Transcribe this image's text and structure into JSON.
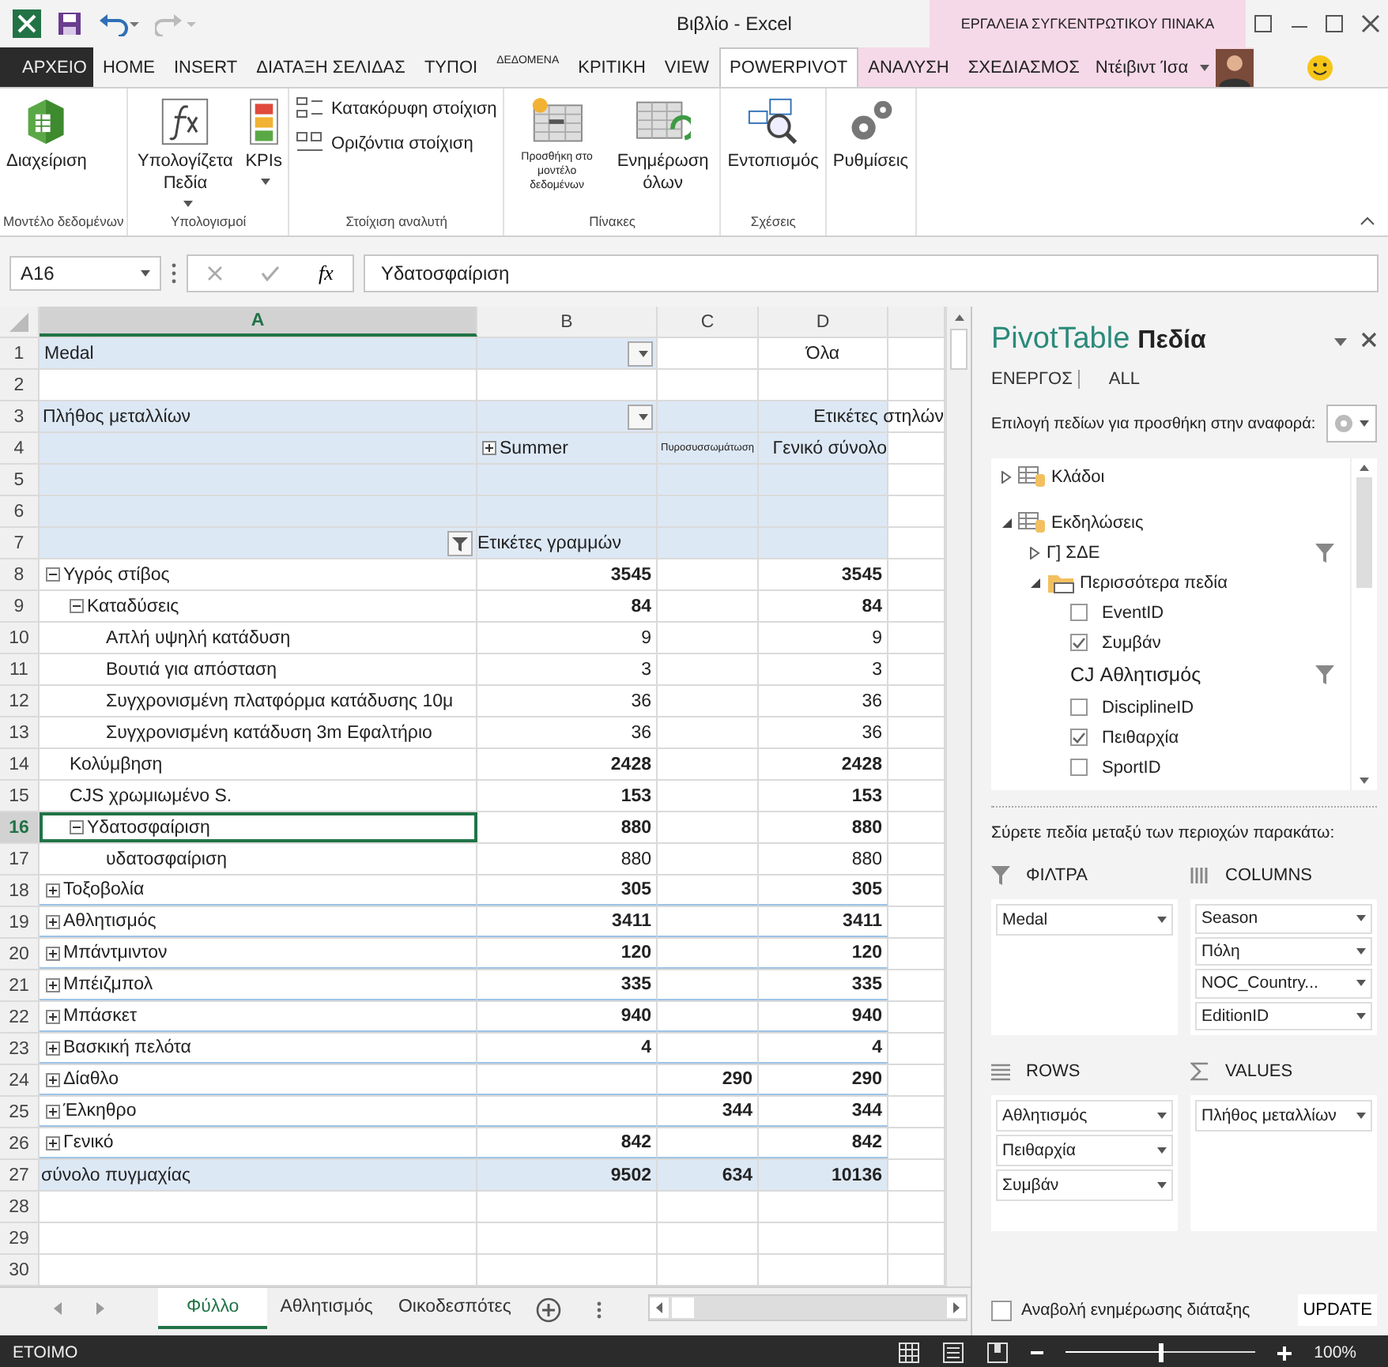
{
  "window": {
    "title": "Βιβλίο - Excel",
    "context_title": "ΕΡΓΑΛΕΙΑ ΣΥΓΚΕΝΤΡΩΤΙΚΟΥ ΠΙΝΑΚΑ",
    "user": "Ντέιβιντ Ίσα"
  },
  "ribbon": {
    "tabs": [
      {
        "label": "ΑΡΧΕΙΟ",
        "kind": "file",
        "selected": false
      },
      {
        "label": "HOME",
        "kind": "tab",
        "selected": false
      },
      {
        "label": "INSERT",
        "kind": "tab",
        "selected": false
      },
      {
        "label": "ΔΙΑΤΑΞΗ ΣΕΛΙΔΑΣ",
        "kind": "tab",
        "selected": false
      },
      {
        "label": "ΤΥΠΟΙ",
        "kind": "tab",
        "selected": false
      },
      {
        "label": "ΔΕΔΟΜΕΝΑ",
        "kind": "compact",
        "selected": false
      },
      {
        "label": "ΚΡΙΤΙΚΗ",
        "kind": "tab",
        "selected": false
      },
      {
        "label": "VIEW",
        "kind": "tab",
        "selected": false
      },
      {
        "label": "POWERPIVOT",
        "kind": "tab",
        "selected": true
      },
      {
        "label": "ΑΝΑΛΥΣΗ",
        "kind": "context",
        "selected": false
      },
      {
        "label": "ΣΧΕΔΙΑΣΜΟΣ",
        "kind": "context",
        "selected": false
      }
    ],
    "groups": [
      {
        "label": "Μοντέλο δεδομένων",
        "buttons": [
          {
            "label": "Διαχείριση",
            "kind": "large",
            "dropdown": false
          }
        ]
      },
      {
        "label": "Υπολογισμοί",
        "buttons": [
          {
            "label": "Υπολογίζετα Πεδία",
            "kind": "large",
            "dropdown": true
          },
          {
            "label": "KPIs",
            "kind": "large",
            "dropdown": true
          }
        ]
      },
      {
        "label": "Στοίχιση αναλυτή",
        "buttons": [
          {
            "label": "Κατακόρυφη στοίχιση",
            "kind": "small",
            "dropdown": false
          },
          {
            "label": "Οριζόντια στοίχιση",
            "kind": "small",
            "dropdown": false
          }
        ]
      },
      {
        "label": "Πίνακες",
        "buttons": [
          {
            "label": "Προσθήκη στο μοντέλο δεδομένων",
            "kind": "compact",
            "dropdown": false
          },
          {
            "label": "Ενημέρωση όλων",
            "kind": "large",
            "dropdown": false
          }
        ]
      },
      {
        "label": "Σχέσεις",
        "buttons": [
          {
            "label": "Εντοπισμός",
            "kind": "large",
            "dropdown": false
          }
        ]
      },
      {
        "buttons": [
          {
            "label": "Ρυθμίσεις",
            "kind": "large",
            "dropdown": false
          }
        ]
      }
    ]
  },
  "formula_bar": {
    "name_box": "A16",
    "function_button": "fx",
    "formula": "Υδατοσφαίριση"
  },
  "sheet": {
    "columns": [
      {
        "label": "A",
        "selected": true
      },
      {
        "label": "B",
        "selected": false
      },
      {
        "label": "C",
        "selected": false
      },
      {
        "label": "D",
        "selected": false
      }
    ],
    "rows": [
      {
        "number": "1",
        "kind": "filter",
        "label": "Medal",
        "value": "Όλα"
      },
      {
        "number": "2",
        "kind": "blank"
      },
      {
        "number": "3",
        "kind": "values_header",
        "label": "Πλήθος μεταλλίων",
        "note": "Ετικέτες στηλών"
      },
      {
        "number": "4",
        "kind": "column_labels",
        "labels": [
          "Summer",
          "Πυροσυσσωμάτωση",
          "Γενικό σύνολο"
        ]
      },
      {
        "number": "5",
        "kind": "header_blank"
      },
      {
        "number": "6",
        "kind": "header_blank"
      },
      {
        "number": "7",
        "kind": "row_labels",
        "caption": "Ετικέτες γραμμών"
      },
      {
        "number": "8",
        "kind": "item",
        "label": "Υγρός στίβος",
        "expanded": true,
        "selected": false,
        "values": {
          "b": "3545",
          "d": "3545"
        },
        "children": [
          {
            "number": "9",
            "kind": "item",
            "label": "Καταδύσεις",
            "expanded": true,
            "selected": false,
            "values": {
              "b": "84",
              "d": "84"
            },
            "children": [
              {
                "number": "10",
                "kind": "item",
                "label": "Απλή υψηλή κατάδυση",
                "selected": false,
                "values": {
                  "b": "9",
                  "d": "9"
                }
              },
              {
                "number": "11",
                "kind": "item",
                "label": "Βουτιά για απόσταση",
                "selected": false,
                "values": {
                  "b": "3",
                  "d": "3"
                }
              },
              {
                "number": "12",
                "kind": "item",
                "label": "Συγχρονισμένη πλατφόρμα κατάδυσης 10μ",
                "selected": false,
                "values": {
                  "b": "36",
                  "d": "36"
                }
              },
              {
                "number": "13",
                "kind": "item",
                "label": "Συγχρονισμένη κατάδυση 3m Εφαλτήριο",
                "selected": false,
                "values": {
                  "b": "36",
                  "d": "36"
                }
              }
            ]
          },
          {
            "number": "14",
            "kind": "item",
            "label": "Κολύμβηση",
            "selected": false,
            "values": {
              "b": "2428",
              "d": "2428"
            }
          },
          {
            "number": "15",
            "kind": "item",
            "label": "CJS χρωμιωμένο S.",
            "selected": false,
            "values": {
              "b": "153",
              "d": "153"
            }
          },
          {
            "number": "16",
            "kind": "item",
            "label": "Υδατοσφαίριση",
            "expanded": true,
            "selected": true,
            "values": {
              "b": "880",
              "d": "880"
            },
            "children": [
              {
                "number": "17",
                "kind": "item",
                "label": "υδατοσφαίριση",
                "selected": false,
                "values": {
                  "b": "880",
                  "d": "880"
                }
              }
            ]
          }
        ]
      },
      {
        "number": "18",
        "kind": "item",
        "label": "Τοξοβολία",
        "expanded": false,
        "selected": false,
        "values": {
          "b": "305",
          "d": "305"
        }
      },
      {
        "number": "19",
        "kind": "item",
        "label": "Αθλητισμός",
        "expanded": false,
        "selected": false,
        "values": {
          "b": "3411",
          "d": "3411"
        }
      },
      {
        "number": "20",
        "kind": "item",
        "label": "Μπάντμιντον",
        "expanded": false,
        "selected": false,
        "values": {
          "b": "120",
          "d": "120"
        }
      },
      {
        "number": "21",
        "kind": "item",
        "label": "Μπέιζμπολ",
        "expanded": false,
        "selected": false,
        "values": {
          "b": "335",
          "d": "335"
        }
      },
      {
        "number": "22",
        "kind": "item",
        "label": "Μπάσκετ",
        "expanded": false,
        "selected": false,
        "values": {
          "b": "940",
          "d": "940"
        }
      },
      {
        "number": "23",
        "kind": "item",
        "label": "Βασκική πελότα",
        "expanded": false,
        "selected": false,
        "values": {
          "b": "4",
          "d": "4"
        }
      },
      {
        "number": "24",
        "kind": "item",
        "label": "Δίαθλο",
        "expanded": false,
        "selected": false,
        "values": {
          "c": "290",
          "d": "290"
        }
      },
      {
        "number": "25",
        "kind": "item",
        "label": "Έλκηθρο",
        "expanded": false,
        "selected": false,
        "values": {
          "c": "344",
          "d": "344"
        }
      },
      {
        "number": "26",
        "kind": "item",
        "label": "Γενικό",
        "expanded": false,
        "selected": false,
        "values": {
          "b": "842",
          "d": "842"
        }
      },
      {
        "number": "27",
        "kind": "total",
        "label": "σύνολο πυγμαχίας",
        "values": {
          "b": "9502",
          "c": "634",
          "d": "10136"
        }
      },
      {
        "number": "28",
        "kind": "blank"
      },
      {
        "number": "29",
        "kind": "blank"
      },
      {
        "number": "30",
        "kind": "blank"
      }
    ],
    "tabs": [
      {
        "label": "Φύλλο",
        "selected": true
      },
      {
        "label": "Αθλητισμός",
        "selected": false
      },
      {
        "label": "Οικοδεσπότες",
        "selected": false
      }
    ]
  },
  "pivot_pane": {
    "title": "PivotTable",
    "title_bold": "Πεδία",
    "tabs": [
      {
        "label": "ΕΝΕΡΓΟΣ",
        "selected": true
      },
      {
        "label": "ALL",
        "selected": false
      }
    ],
    "instruction": "Επιλογή πεδίων για προσθήκη στην αναφορά:",
    "fields": [
      {
        "label": "Κλάδοι",
        "kind": "table",
        "expanded": false
      },
      {
        "label": "Εκδηλώσεις",
        "kind": "table",
        "expanded": true,
        "children": [
          {
            "label": "Γ] ΣΔΕ",
            "kind": "group",
            "expanded": false,
            "filtered": true
          },
          {
            "label": "Περισσότερα πεδία",
            "kind": "folder",
            "expanded": true,
            "children": [
              {
                "label": "EventID",
                "kind": "field",
                "checked": false
              },
              {
                "label": "Συμβάν",
                "kind": "field",
                "checked": true
              },
              {
                "label": "CJ Αθλητισμός",
                "kind": "heading",
                "filtered": true
              },
              {
                "label": "DisciplineID",
                "kind": "field",
                "checked": false
              },
              {
                "label": "Πειθαρχία",
                "kind": "field",
                "checked": true
              },
              {
                "label": "SportID",
                "kind": "field",
                "checked": false
              }
            ]
          }
        ]
      }
    ],
    "drag_hint": "Σύρετε πεδία μεταξύ των περιοχών παρακάτω:",
    "areas": [
      {
        "label": "ΦΙΛΤΡΑ",
        "kind": "filters",
        "items": [
          "Medal"
        ]
      },
      {
        "label": "COLUMNS",
        "kind": "columns",
        "items": [
          "Season",
          "Πόλη",
          "NOC_Country...",
          "EditionID"
        ]
      },
      {
        "label": "ROWS",
        "kind": "rows",
        "items": [
          "Αθλητισμός",
          "Πειθαρχία",
          "Συμβάν"
        ]
      },
      {
        "label": "VALUES",
        "kind": "values",
        "items": [
          "Πλήθος μεταλλίων"
        ]
      }
    ],
    "defer_update": {
      "label": "Αναβολή ενημέρωσης διάταξης",
      "checked": false
    },
    "update_button": "UPDATE"
  },
  "status_bar": {
    "status": "ΕΤΟΙΜΟ",
    "zoom": {
      "level": 0.5,
      "reading": "100%"
    }
  }
}
